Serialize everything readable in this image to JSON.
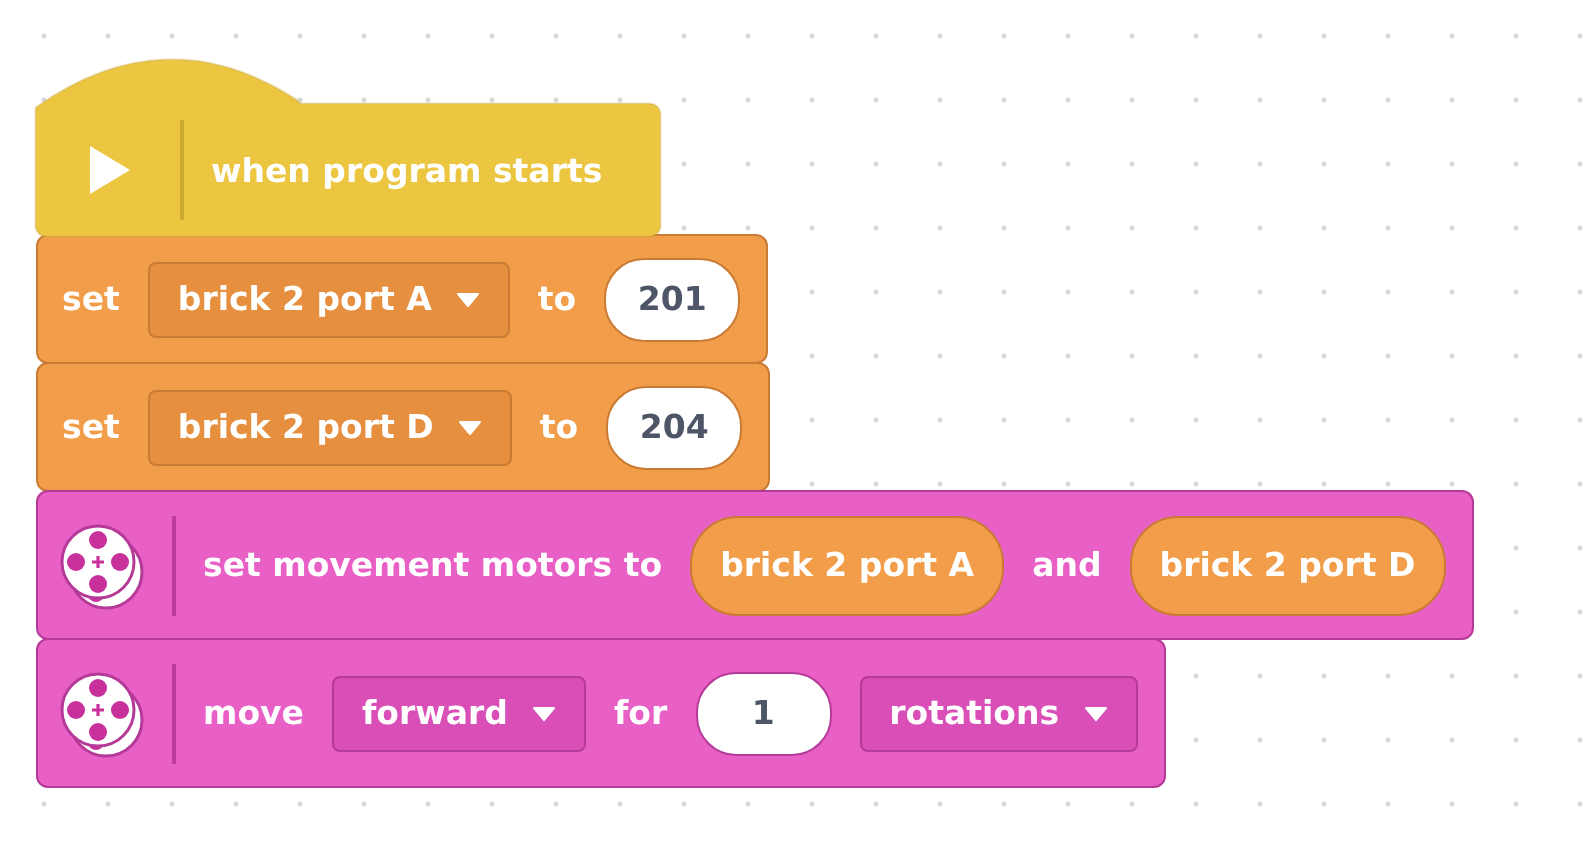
{
  "blocks": [
    {
      "kind": "hat",
      "parts": [
        {
          "kind": "label",
          "text": "when program starts"
        }
      ]
    },
    {
      "kind": "variable",
      "parts": [
        {
          "kind": "label",
          "text": "set"
        },
        {
          "kind": "dropdown",
          "text": "brick 2 port A"
        },
        {
          "kind": "label",
          "text": "to"
        },
        {
          "kind": "number",
          "text": "201"
        }
      ]
    },
    {
      "kind": "variable",
      "parts": [
        {
          "kind": "label",
          "text": "set"
        },
        {
          "kind": "dropdown",
          "text": "brick 2 port D"
        },
        {
          "kind": "label",
          "text": "to"
        },
        {
          "kind": "number",
          "text": "204"
        }
      ]
    },
    {
      "kind": "motor",
      "parts": [
        {
          "kind": "label",
          "text": "set movement motors to"
        },
        {
          "kind": "reporter",
          "text": "brick 2 port A"
        },
        {
          "kind": "label",
          "text": "and"
        },
        {
          "kind": "reporter",
          "text": "brick 2 port D"
        }
      ]
    },
    {
      "kind": "motor",
      "parts": [
        {
          "kind": "label",
          "text": "move"
        },
        {
          "kind": "dropdown",
          "text": "forward"
        },
        {
          "kind": "label",
          "text": "for"
        },
        {
          "kind": "number",
          "text": "1"
        },
        {
          "kind": "dropdown",
          "text": "rotations"
        }
      ]
    }
  ]
}
